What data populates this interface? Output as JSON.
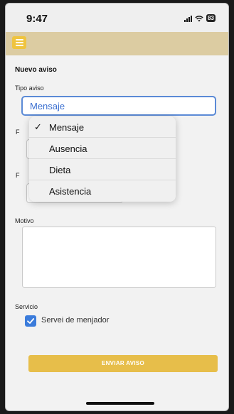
{
  "status_bar": {
    "time": "9:47",
    "battery": "83"
  },
  "form": {
    "title": "Nuevo aviso",
    "tipo_label": "Tipo aviso",
    "tipo_value": "Mensaje",
    "field2_label_partial": "F",
    "field3_label_partial": "F",
    "motivo_label": "Motivo",
    "servicio_label": "Servicio",
    "servicio_option": "Servei de menjador",
    "submit_label": "ENVIAR AVISO"
  },
  "dropdown": {
    "options": [
      {
        "label": "Mensaje",
        "selected": true
      },
      {
        "label": "Ausencia",
        "selected": false
      },
      {
        "label": "Dieta",
        "selected": false
      },
      {
        "label": "Asistencia",
        "selected": false
      }
    ]
  },
  "colors": {
    "app_bar": "#dccca2",
    "menu_button": "#efc43f",
    "accent_blue": "#3b7cdb",
    "submit_button": "#e7be4a"
  },
  "icons": {
    "menu": "hamburger-icon",
    "check": "checkmark-icon",
    "signal": "signal-icon",
    "wifi": "wifi-icon",
    "battery": "battery-icon"
  }
}
